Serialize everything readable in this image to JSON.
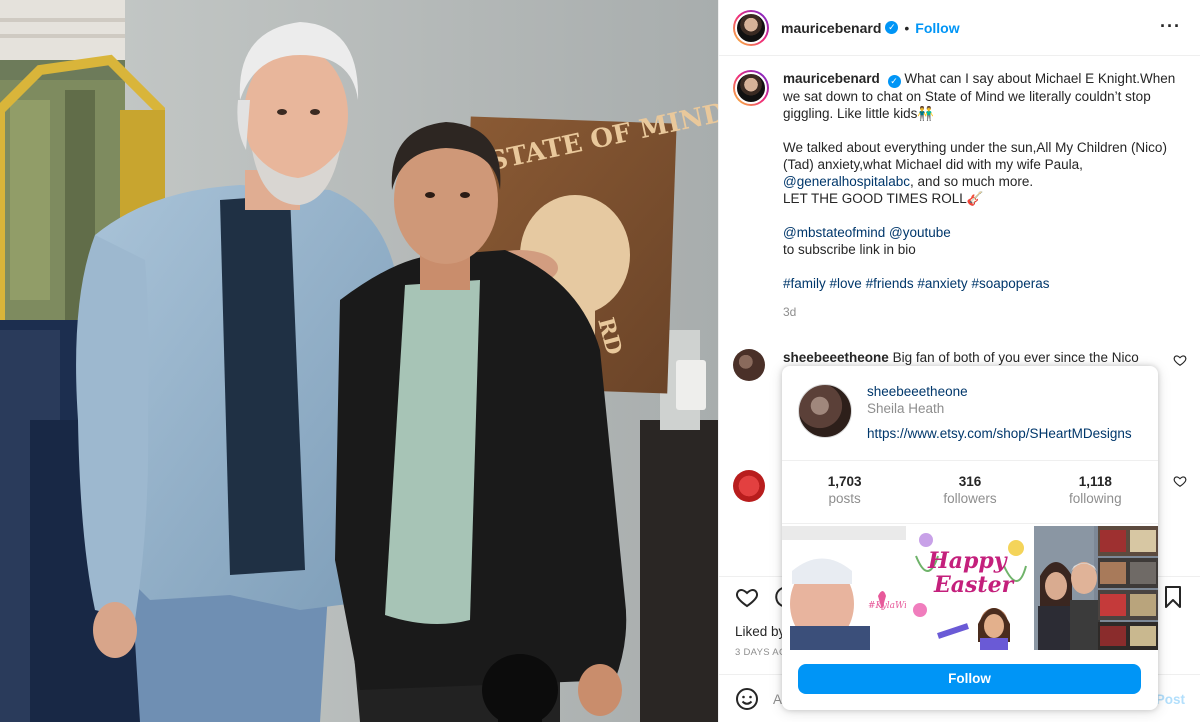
{
  "header": {
    "username": "mauricebenard",
    "separator": "•",
    "follow_label": "Follow",
    "more_icon": "more-horizontal-icon"
  },
  "caption": {
    "username": "mauricebenard",
    "line1": "What can I say about Michael E Knight.When we sat down to chat on State of Mind we literally couldn’t stop giggling. Like little kids👬",
    "line2_a": "We talked about everything under the sun,All My Children (Nico)(Tad) anxiety,what Michael did with my wife Paula,",
    "line2_mention": "@generalhospitalabc",
    "line2_b": ", and so much more.",
    "line2_c": "LET THE GOOD TIMES ROLL🎸",
    "mention1": "@mbstateofmind",
    "mention2": "@youtube",
    "line3": "to subscribe link in bio",
    "hashtags": [
      "#family",
      "#love",
      "#friends",
      "#anxiety",
      "#soapoperas"
    ],
    "time": "3d"
  },
  "photo": {
    "sign_text": "STATE OF MIND",
    "sign_text2": "RD"
  },
  "comments": [
    {
      "username": "sheebeeetheone",
      "text": "Big fan of both of you ever since the Nico"
    }
  ],
  "actions": {
    "liked_label": "Liked by",
    "days_ago": "3 DAYS AG",
    "add_comment_placeholder": "A",
    "post_label": "Post"
  },
  "hovercard": {
    "username": "sheebeeetheone",
    "full_name": "Sheila Heath",
    "link": "https://www.etsy.com/shop/SHeartMDesigns",
    "stats": [
      {
        "num": "1,703",
        "label": "posts"
      },
      {
        "num": "316",
        "label": "followers"
      },
      {
        "num": "1,118",
        "label": "following"
      }
    ],
    "thumb1_text": "#KylaWick",
    "thumb2_text1": "Happy",
    "thumb2_text2": "Easter",
    "follow_label": "Follow"
  },
  "colors": {
    "accent": "#0095f6",
    "link": "#00376b",
    "muted": "#8e8e8e",
    "text": "#262626"
  }
}
